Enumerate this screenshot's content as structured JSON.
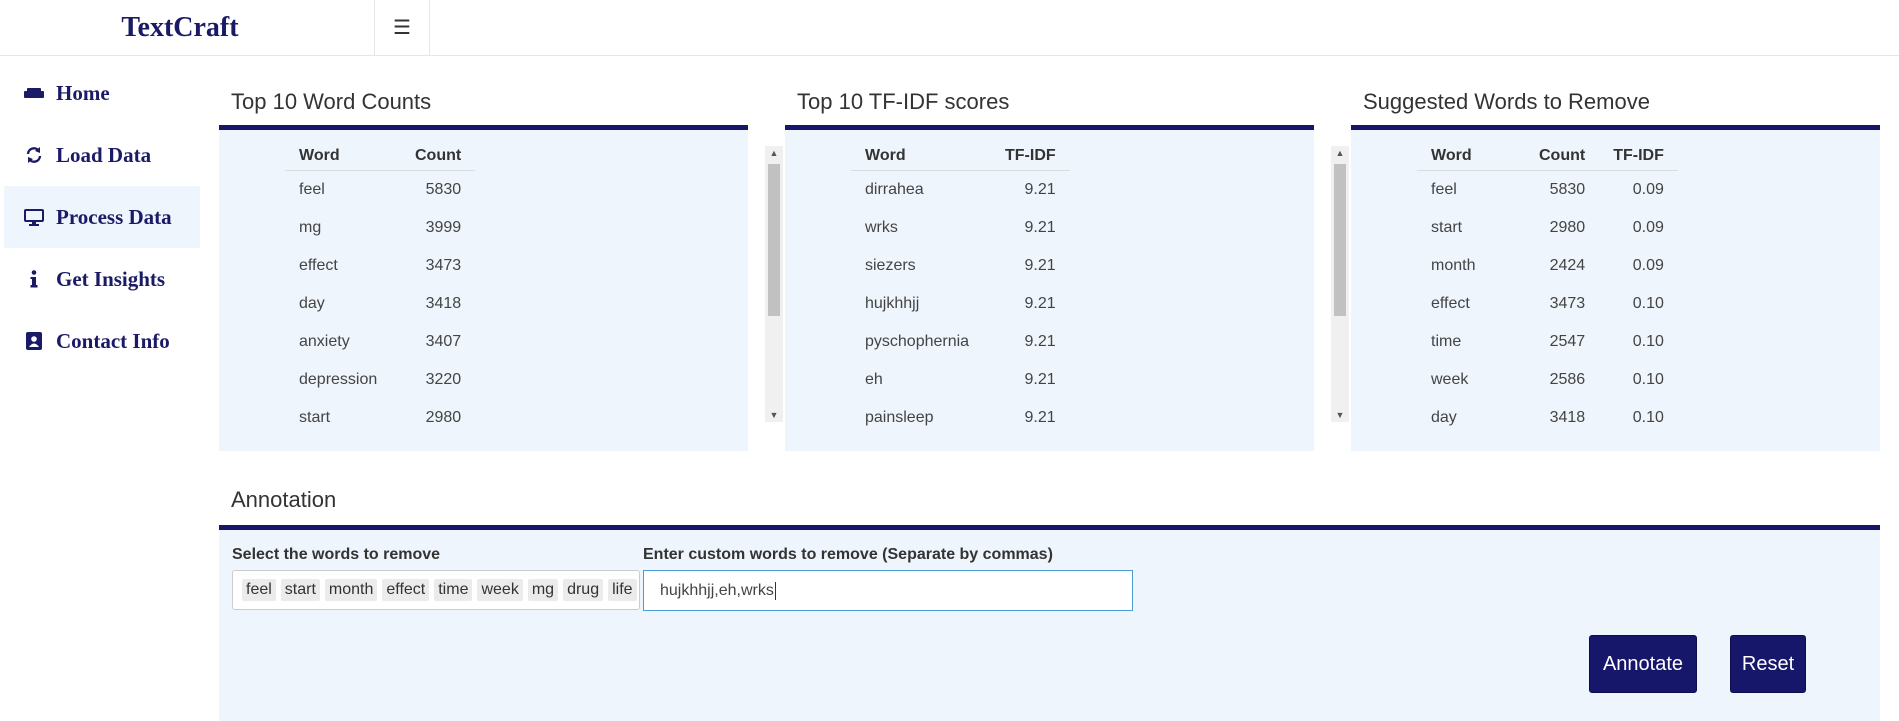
{
  "app": {
    "brand": "TextCraft",
    "menu_icon": "hamburger-icon"
  },
  "sidebar": {
    "items": [
      {
        "label": "Home",
        "icon": "couch-icon",
        "active": false
      },
      {
        "label": "Load Data",
        "icon": "refresh-icon",
        "active": false
      },
      {
        "label": "Process Data",
        "icon": "desktop-icon",
        "active": true
      },
      {
        "label": "Get Insights",
        "icon": "info-icon",
        "active": false
      },
      {
        "label": "Contact Info",
        "icon": "address-book-icon",
        "active": false
      }
    ]
  },
  "word_counts": {
    "title": "Top 10 Word Counts",
    "headers": [
      "Word",
      "Count"
    ],
    "rows": [
      [
        "feel",
        "5830"
      ],
      [
        "mg",
        "3999"
      ],
      [
        "effect",
        "3473"
      ],
      [
        "day",
        "3418"
      ],
      [
        "anxiety",
        "3407"
      ],
      [
        "depression",
        "3220"
      ],
      [
        "start",
        "2980"
      ]
    ]
  },
  "tfidf": {
    "title": "Top 10 TF-IDF scores",
    "headers": [
      "Word",
      "TF-IDF"
    ],
    "rows": [
      [
        "dirrahea",
        "9.21"
      ],
      [
        "wrks",
        "9.21"
      ],
      [
        "siezers",
        "9.21"
      ],
      [
        "hujkhhjj",
        "9.21"
      ],
      [
        "pyschophernia",
        "9.21"
      ],
      [
        "eh",
        "9.21"
      ],
      [
        "painsleep",
        "9.21"
      ]
    ]
  },
  "suggested": {
    "title": "Suggested Words to Remove",
    "headers": [
      "Word",
      "Count",
      "TF-IDF"
    ],
    "rows": [
      [
        "feel",
        "5830",
        "0.09"
      ],
      [
        "start",
        "2980",
        "0.09"
      ],
      [
        "month",
        "2424",
        "0.09"
      ],
      [
        "effect",
        "3473",
        "0.10"
      ],
      [
        "time",
        "2547",
        "0.10"
      ],
      [
        "week",
        "2586",
        "0.10"
      ],
      [
        "day",
        "3418",
        "0.10"
      ]
    ]
  },
  "annotation": {
    "title": "Annotation",
    "select_label": "Select the words to remove",
    "selected_words": [
      "feel",
      "start",
      "month",
      "effect",
      "time",
      "week",
      "mg",
      "drug",
      "life"
    ],
    "custom_label": "Enter custom words to remove (Separate by commas)",
    "custom_value": "hujkhhjj,eh,wrks",
    "annotate_button": "Annotate",
    "reset_button": "Reset"
  },
  "colors": {
    "brand": "#1a1a66",
    "accent": "#16166b",
    "panel": "#eef5fc"
  }
}
